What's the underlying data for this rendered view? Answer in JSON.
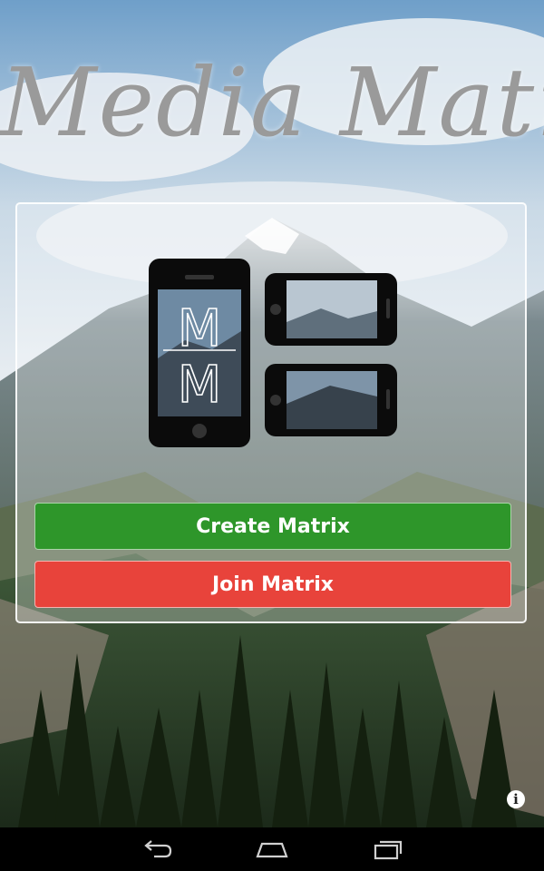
{
  "app": {
    "title": "Media Matrix"
  },
  "logo": {
    "letters": "M M"
  },
  "buttons": {
    "create_label": "Create Matrix",
    "join_label": "Join Matrix"
  },
  "icons": {
    "info": "info-icon",
    "back": "back-icon",
    "home": "home-icon",
    "recents": "recent-apps-icon"
  },
  "colors": {
    "create": "#2e962a",
    "join": "#e8433b",
    "title": "#9a9a9a"
  }
}
